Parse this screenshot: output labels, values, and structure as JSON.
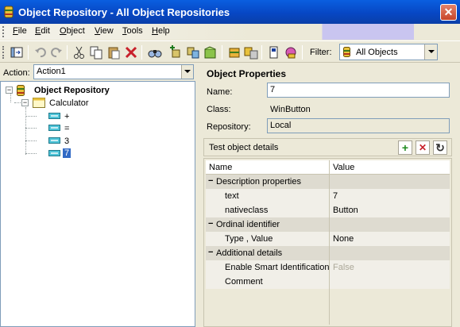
{
  "window": {
    "title": "Object Repository - All Object Repositories",
    "close_glyph": "✕"
  },
  "menu": [
    {
      "label": "File",
      "key": "F",
      "rest": "ile"
    },
    {
      "label": "Edit",
      "key": "E",
      "rest": "dit"
    },
    {
      "label": "Object",
      "key": "O",
      "rest": "bject"
    },
    {
      "label": "View",
      "key": "V",
      "rest": "iew"
    },
    {
      "label": "Tools",
      "key": "T",
      "rest": "ools"
    },
    {
      "label": "Help",
      "key": "H",
      "rest": "elp"
    }
  ],
  "toolbar": {
    "icons": [
      "navigate-locate-icon",
      "undo-icon",
      "redo-icon",
      "cut-icon",
      "copy-icon",
      "paste-icon",
      "delete-icon",
      "find-icon",
      "add-objects-icon",
      "update-from-app-icon",
      "define-new-object-icon",
      "object-repository-manager-icon",
      "associate-repositories-icon",
      "highlight-in-app-icon",
      "object-spy-icon"
    ],
    "filter_label": "Filter:",
    "filter_value": "All Objects"
  },
  "left_panel": {
    "action_label": "Action:",
    "action_value": "Action1",
    "tree": {
      "root": "Object Repository",
      "child": "Calculator",
      "leaves": [
        "+",
        "=",
        "3",
        "7"
      ],
      "selected": "7"
    }
  },
  "properties": {
    "title": "Object Properties",
    "name_label": "Name:",
    "name_value": "7",
    "class_label": "Class:",
    "class_value": "WinButton",
    "repository_label": "Repository:",
    "repository_value": "Local",
    "details_title": "Test object details",
    "columns": {
      "name": "Name",
      "value": "Value"
    },
    "groups": [
      {
        "label": "Description properties",
        "rows": [
          {
            "name": "text",
            "value": "7"
          },
          {
            "name": "nativeclass",
            "value": "Button"
          }
        ]
      },
      {
        "label": "Ordinal identifier",
        "rows": [
          {
            "name": "Type , Value",
            "value": "None"
          }
        ]
      },
      {
        "label": "Additional details",
        "rows": [
          {
            "name": "Enable Smart Identification",
            "value": "False"
          },
          {
            "name": "Comment",
            "value": ""
          }
        ]
      }
    ]
  },
  "colors": {
    "title_bar": "#0A5FE0",
    "selection": "#316AC5",
    "grid_category": "#DEDBD0"
  }
}
